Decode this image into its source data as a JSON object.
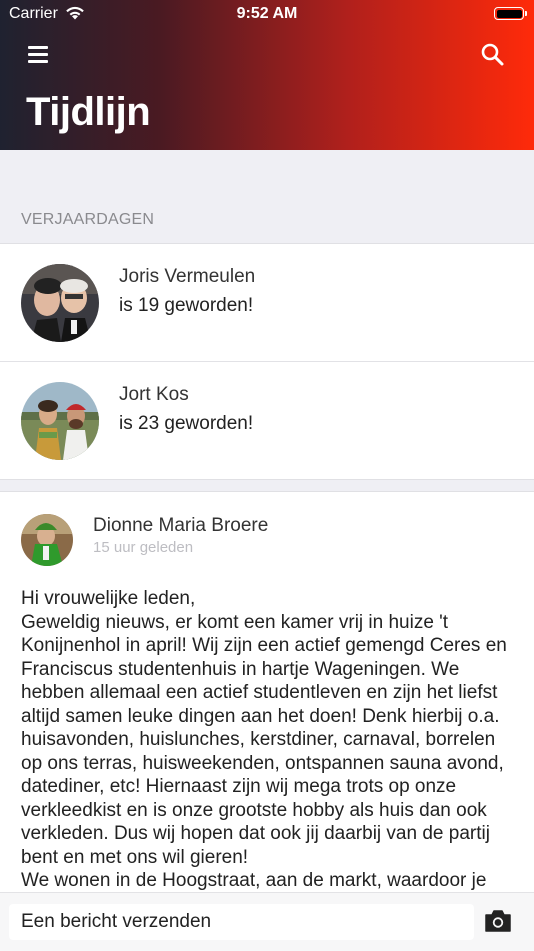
{
  "status_bar": {
    "carrier": "Carrier",
    "time": "9:52 AM"
  },
  "header": {
    "title": "Tijdlijn"
  },
  "birthdays": {
    "section_title": "VERJAARDAGEN",
    "items": [
      {
        "name": "Joris Vermeulen",
        "message": "is 19 geworden!"
      },
      {
        "name": "Jort Kos",
        "message": "is 23 geworden!"
      }
    ]
  },
  "post": {
    "author": "Dionne Maria Broere",
    "time": "15 uur geleden",
    "body": "Hi vrouwelijke leden,\nGeweldig nieuws, er komt een kamer vrij in huize 't Konijnenhol in april! Wij zijn een actief gemengd Ceres en Franciscus studentenhuis in hartje Wageningen. We hebben allemaal een actief studentleven en zijn het liefst altijd samen leuke dingen aan het doen! Denk hierbij o.a. huisavonden, huislunches, kerstdiner, carnaval, borrelen op ons terras, huisweekenden, ontspannen sauna avond, datediner, etc! Hiernaast zijn wij mega trots op onze verkleedkist en is onze grootste hobby als huis dan ook verkleden. Dus wij hopen dat ook jij daarbij van de partij bent en met ons wil gieren!\nWe wonen in de Hoogstraat, aan de markt, waardoor je"
  },
  "composer": {
    "placeholder": "Een bericht verzenden"
  },
  "colors": {
    "header_start": "#1f2230",
    "header_end": "#ff2a0a"
  }
}
